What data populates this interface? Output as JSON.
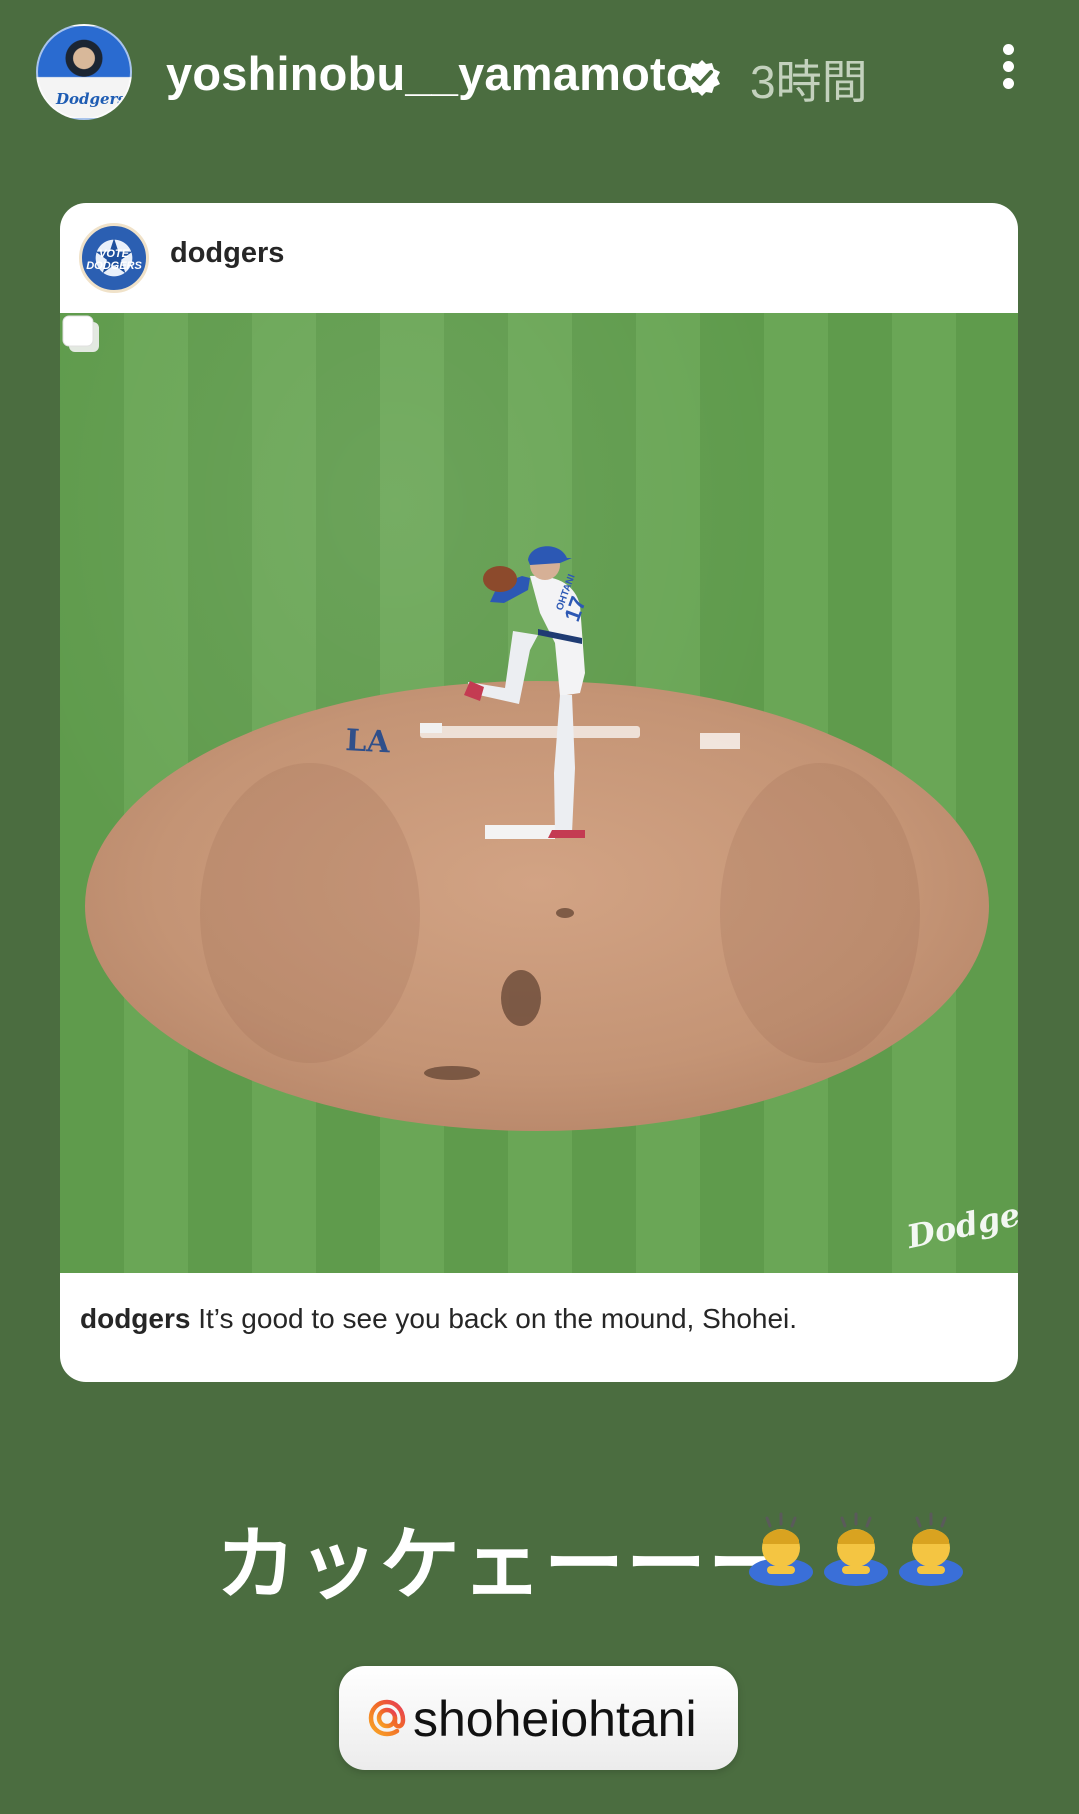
{
  "header": {
    "username": "yoshinobu__yamamoto",
    "time_ago": "3時間",
    "avatar_text": "Dodgers"
  },
  "card": {
    "account": "dodgers",
    "avatar_text": "VOTE DODGERS",
    "caption_account": "dodgers",
    "caption_text": " It’s good to see you back on the mound, Shohei.",
    "watermark": "Dodgers",
    "jersey_name": "OHTANI",
    "jersey_number": "17",
    "mound_logo": "LA"
  },
  "story": {
    "text": "カッケェーーー",
    "emoji_count": 3
  },
  "mention": {
    "handle": "shoheiohtani"
  },
  "colors": {
    "background": "#4b6d40",
    "verified": "#ffffff",
    "card": "#ffffff"
  },
  "icons": [
    "verified-badge-icon",
    "more-options-icon",
    "multiple-photos-icon",
    "threads-at-icon",
    "bowing-person-emoji"
  ]
}
